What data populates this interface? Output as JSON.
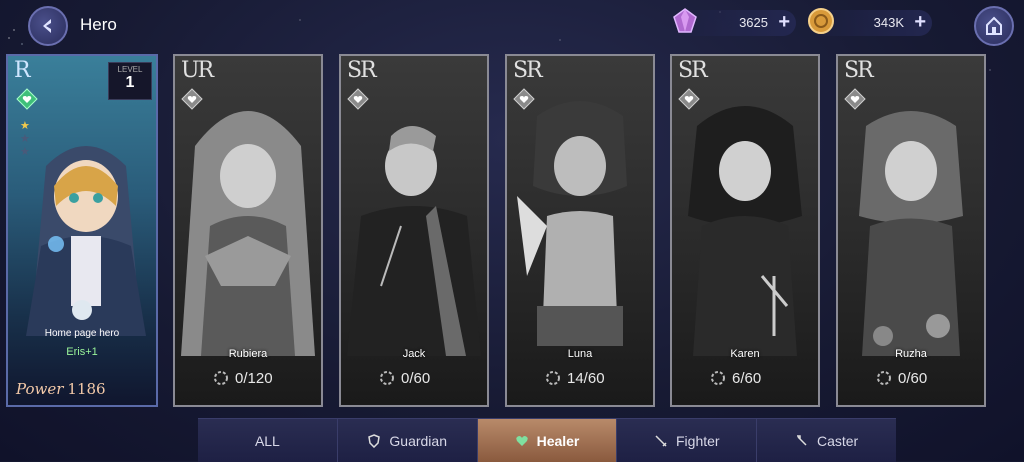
{
  "header": {
    "title": "Hero",
    "gems": "3625",
    "coins": "343K",
    "plus": "+"
  },
  "selected": {
    "rank": "R",
    "level_label": "LEVEL",
    "level": "1",
    "home_label": "Home page hero",
    "hero_name": "Eris+1",
    "power_label": "Power",
    "power": "1186"
  },
  "cards": [
    {
      "rank": "UR",
      "name": "Rubiera",
      "shards": "0/120"
    },
    {
      "rank": "SR",
      "name": "Jack",
      "shards": "0/60"
    },
    {
      "rank": "SR",
      "name": "Luna",
      "shards": "14/60"
    },
    {
      "rank": "SR",
      "name": "Karen",
      "shards": "6/60"
    },
    {
      "rank": "SR",
      "name": "Ruzha",
      "shards": "0/60"
    }
  ],
  "filters": [
    {
      "label": "ALL"
    },
    {
      "label": "Guardian"
    },
    {
      "label": "Healer"
    },
    {
      "label": "Fighter"
    },
    {
      "label": "Caster"
    }
  ],
  "colors": {
    "accent": "#b88a6a",
    "heal_green": "#7fe0a0",
    "power": "#f3c9a8"
  }
}
